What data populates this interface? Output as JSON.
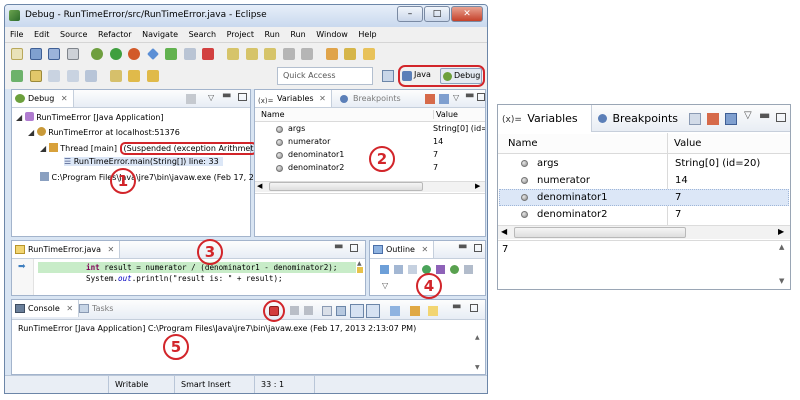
{
  "window": {
    "title": "Debug - RunTimeError/src/RunTimeError.java - Eclipse",
    "min_label": "–",
    "max_label": "□",
    "close_label": "✕"
  },
  "menu": [
    "File",
    "Edit",
    "Source",
    "Refactor",
    "Navigate",
    "Search",
    "Project",
    "Run",
    "Run",
    "Window",
    "Help"
  ],
  "toolbar2": {
    "quick_access_placeholder": "Quick Access",
    "perspective_java": "Java",
    "perspective_debug": "Debug"
  },
  "debug_view": {
    "tab_label": "Debug",
    "tree": [
      {
        "text": "RunTimeError [Java Application]"
      },
      {
        "text": "RunTimeError at localhost:51376"
      },
      {
        "text": "Thread [main]",
        "suspended": "(Suspended (exception Arithmet"
      },
      {
        "text": "RunTimeError.main(String[]) line: 33"
      },
      {
        "text": "C:\\Program Files\\Java\\jre7\\bin\\javaw.exe (Feb 17, 2"
      }
    ]
  },
  "variables_view": {
    "tab_variables": "Variables",
    "tab_breakpoints": "Breakpoints",
    "col_name": "Name",
    "col_value": "Value",
    "rows": [
      {
        "name": "args",
        "value": "String[0]  (id=2"
      },
      {
        "name": "numerator",
        "value": "14"
      },
      {
        "name": "denominator1",
        "value": "7"
      },
      {
        "name": "denominator2",
        "value": "7"
      }
    ]
  },
  "editor": {
    "tab_label": "RunTimeError.java",
    "line1_kw": "int",
    "line1_rest": " result = numerator / (denominator1 - denominator2);",
    "line2_pre": "System.",
    "line2_out": "out",
    "line2_post": ".println(\"result is: \" + result);"
  },
  "outline": {
    "tab_label": "Outline"
  },
  "console": {
    "tab_console": "Console",
    "tab_tasks": "Tasks",
    "text": "RunTimeError [Java Application] C:\\Program Files\\Java\\jre7\\bin\\javaw.exe (Feb 17, 2013 2:13:07 PM)"
  },
  "status": {
    "writable": "Writable",
    "insert_mode": "Smart Insert",
    "position": "33 : 1"
  },
  "callouts": [
    "1",
    "2",
    "3",
    "4",
    "5"
  ],
  "right_panel": {
    "tab_variables_prefix": "(x)=",
    "tab_variables": "Variables",
    "tab_breakpoints": "Breakpoints",
    "col_name": "Name",
    "col_value": "Value",
    "rows": [
      {
        "name": "args",
        "value": "String[0]  (id=20)"
      },
      {
        "name": "numerator",
        "value": "14"
      },
      {
        "name": "denominator1",
        "value": "7"
      },
      {
        "name": "denominator2",
        "value": "7"
      }
    ],
    "detail_value": "7"
  },
  "colors": {
    "callout_red": "#d2252a",
    "selection_blue": "#dce7f7",
    "current_line_green": "#c8ecc8",
    "keyword": "#7f0055",
    "static_field": "#0000c0"
  }
}
